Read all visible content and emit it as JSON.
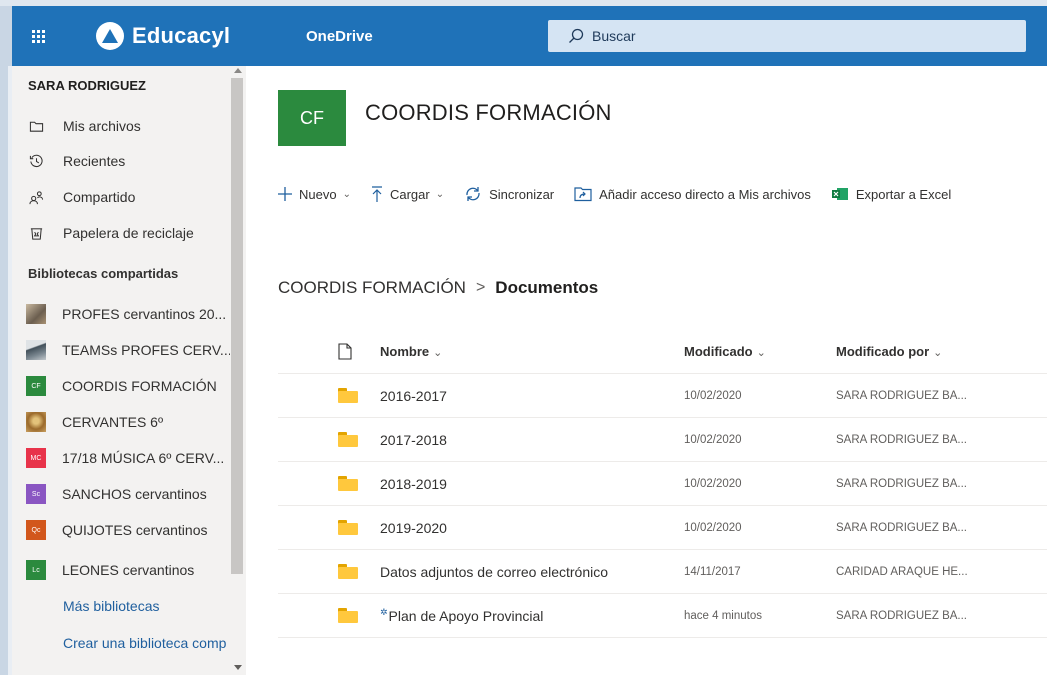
{
  "header": {
    "brand": "Educacyl",
    "app_name": "OneDrive",
    "search_placeholder": "Buscar"
  },
  "sidebar": {
    "user": "SARA RODRIGUEZ",
    "nav": [
      {
        "label": "Mis archivos",
        "icon": "folder-icon"
      },
      {
        "label": "Recientes",
        "icon": "history-icon"
      },
      {
        "label": "Compartido",
        "icon": "people-icon"
      },
      {
        "label": "Papelera de reciclaje",
        "icon": "recycle-bin-icon"
      }
    ],
    "section_title": "Bibliotecas compartidas",
    "libraries": [
      {
        "label": "PROFES cervantinos 20...",
        "tile": "",
        "color": "#8c7b6a"
      },
      {
        "label": "TEAMSs PROFES CERV...",
        "tile": "",
        "color": "#5d6d7a"
      },
      {
        "label": "COORDIS FORMACIÓN",
        "tile": "CF",
        "color": "#2b8a3e"
      },
      {
        "label": "CERVANTES 6º",
        "tile": "",
        "color": "#b07d3a"
      },
      {
        "label": "17/18 MÚSICA 6º CERV...",
        "tile": "MC",
        "color": "#e8334a"
      },
      {
        "label": "SANCHOS cervantinos",
        "tile": "Sc",
        "color": "#8a56c2"
      },
      {
        "label": "QUIJOTES cervantinos",
        "tile": "Qc",
        "color": "#d2571c"
      },
      {
        "label": "LEONES cervantinos",
        "tile": "Lc",
        "color": "#2b8a3e"
      }
    ],
    "more_link": "Más bibliotecas",
    "create_link": "Crear una biblioteca comp"
  },
  "site": {
    "tile": "CF",
    "tile_color": "#2b8a3e",
    "title": "COORDIS FORMACIÓN"
  },
  "commands": {
    "new": "Nuevo",
    "upload": "Cargar",
    "sync": "Sincronizar",
    "shortcut": "Añadir acceso directo a Mis archivos",
    "export": "Exportar a Excel"
  },
  "breadcrumb": {
    "parent": "COORDIS FORMACIÓN",
    "separator": ">",
    "current": "Documentos"
  },
  "table": {
    "headers": {
      "name": "Nombre",
      "modified": "Modificado",
      "modified_by": "Modificado por"
    },
    "rows": [
      {
        "name": "2016-2017",
        "modified": "10/02/2020",
        "modified_by": "SARA RODRIGUEZ BA..."
      },
      {
        "name": "2017-2018",
        "modified": "10/02/2020",
        "modified_by": "SARA RODRIGUEZ BA..."
      },
      {
        "name": "2018-2019",
        "modified": "10/02/2020",
        "modified_by": "SARA RODRIGUEZ BA..."
      },
      {
        "name": "2019-2020",
        "modified": "10/02/2020",
        "modified_by": "SARA RODRIGUEZ BA..."
      },
      {
        "name": "Datos adjuntos de correo electrónico",
        "modified": "14/11/2017",
        "modified_by": "CARIDAD ARAQUE HE..."
      },
      {
        "name": "Plan de Apoyo Provincial",
        "modified": "hace 4 minutos",
        "modified_by": "SARA RODRIGUEZ BA..."
      }
    ]
  }
}
